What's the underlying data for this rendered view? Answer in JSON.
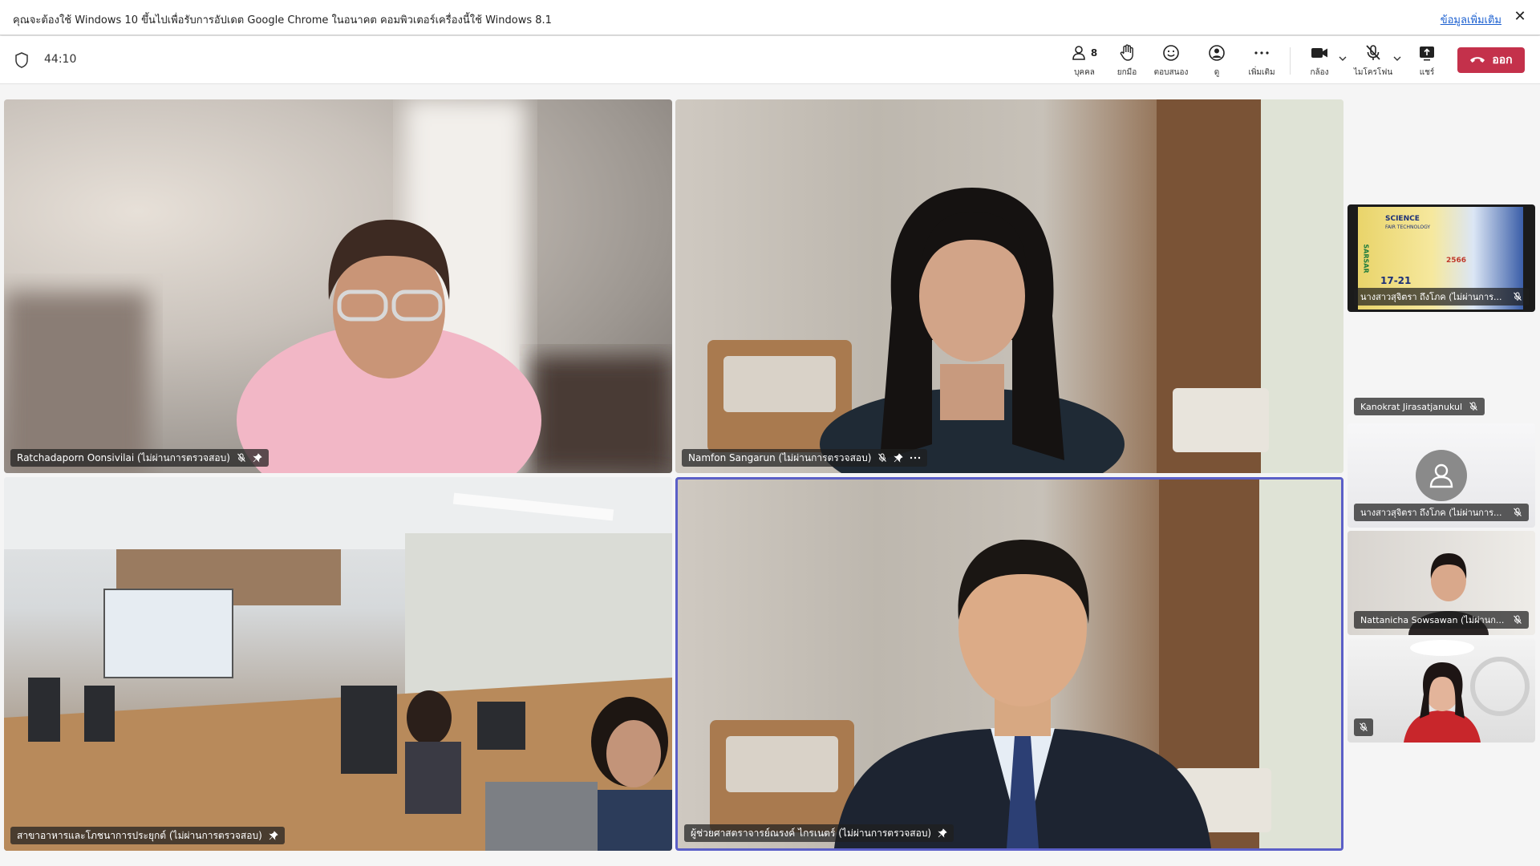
{
  "banner": {
    "text": "คุณจะต้องใช้ Windows 10 ขึ้นไปเพื่อรับการอัปเดต Google Chrome ในอนาคต คอมพิวเตอร์เครื่องนี้ใช้ Windows 8.1",
    "link": "ข้อมูลเพิ่มเติม",
    "close": "✕"
  },
  "toolbar": {
    "timer": "44:10",
    "people_count": "8",
    "people_label": "บุคคล",
    "raise_label": "ยกมือ",
    "react_label": "ตอบสนอง",
    "view_label": "ดู",
    "more_label": "เพิ่มเติม",
    "camera_label": "กล้อง",
    "mic_label": "ไมโครโฟน",
    "share_label": "แชร์",
    "leave_label": "ออก"
  },
  "stage": {
    "tiles": [
      {
        "name": "Ratchadaporn Oonsivilai (ไม่ผ่านการตรวจสอบ)"
      },
      {
        "name": "Namfon Sangarun (ไม่ผ่านการตรวจสอบ)"
      },
      {
        "name": "สาขาอาหารและโภชนาการประยุกต์ (ไม่ผ่านการตรวจสอบ)"
      },
      {
        "name": "ผู้ช่วยศาสตราจารย์ณรงค์ ไกรเนตร์ (ไม่ผ่านการตรวจสอบ)"
      }
    ]
  },
  "sidebar": {
    "tiles": [
      {
        "name": "นางสาวสุจิตรา ถึงโภค (ไม่ผ่านการ..."
      },
      {
        "name": "Kanokrat Jirasatjanukul"
      },
      {
        "name": "นางสาวสุจิตรา ถึงโภค (ไม่ผ่านการ..."
      },
      {
        "name": "Nattanicha Sowsawan (ไม่ผ่านก..."
      },
      {
        "name": ""
      }
    ],
    "poster": {
      "title": "SCIENCE",
      "subtitle": "FAIR TECHNOLOGY",
      "date": "17-21",
      "year": "2566",
      "side": "SARSAR"
    }
  },
  "colors": {
    "leave": "#c4314b",
    "active_border": "#5b5fc7",
    "link": "#1a5fd0"
  }
}
